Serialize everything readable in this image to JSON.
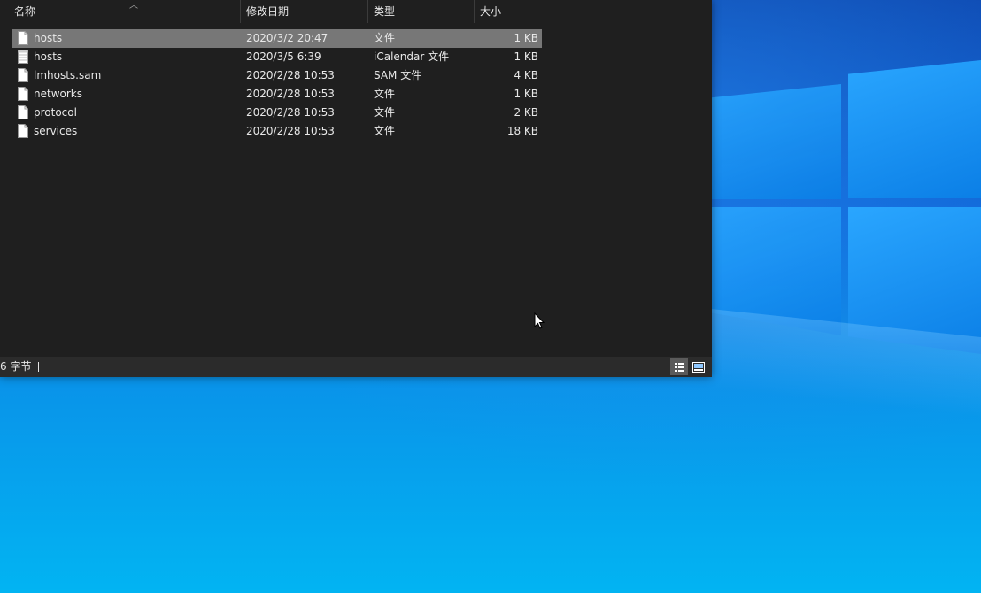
{
  "explorer": {
    "columns": {
      "name": "名称",
      "modified": "修改日期",
      "type": "类型",
      "size": "大小"
    },
    "files": [
      {
        "name": "hosts",
        "modified": "2020/3/2 20:47",
        "type": "文件",
        "size": "1 KB",
        "icon": "file-icon",
        "selected": true
      },
      {
        "name": "hosts",
        "modified": "2020/3/5 6:39",
        "type": "iCalendar 文件",
        "size": "1 KB",
        "icon": "calendar-file-icon",
        "selected": false
      },
      {
        "name": "lmhosts.sam",
        "modified": "2020/2/28 10:53",
        "type": "SAM 文件",
        "size": "4 KB",
        "icon": "file-icon",
        "selected": false
      },
      {
        "name": "networks",
        "modified": "2020/2/28 10:53",
        "type": "文件",
        "size": "1 KB",
        "icon": "file-icon",
        "selected": false
      },
      {
        "name": "protocol",
        "modified": "2020/2/28 10:53",
        "type": "文件",
        "size": "2 KB",
        "icon": "file-icon",
        "selected": false
      },
      {
        "name": "services",
        "modified": "2020/2/28 10:53",
        "type": "文件",
        "size": "18 KB",
        "icon": "file-icon",
        "selected": false
      }
    ],
    "status": {
      "text": "6 字节"
    }
  },
  "colors": {
    "window_bg": "#1f1f1f",
    "selected_row": "#777777",
    "statusbar_bg": "#2b2b2b",
    "desktop_blue": "#0a8fe8"
  }
}
